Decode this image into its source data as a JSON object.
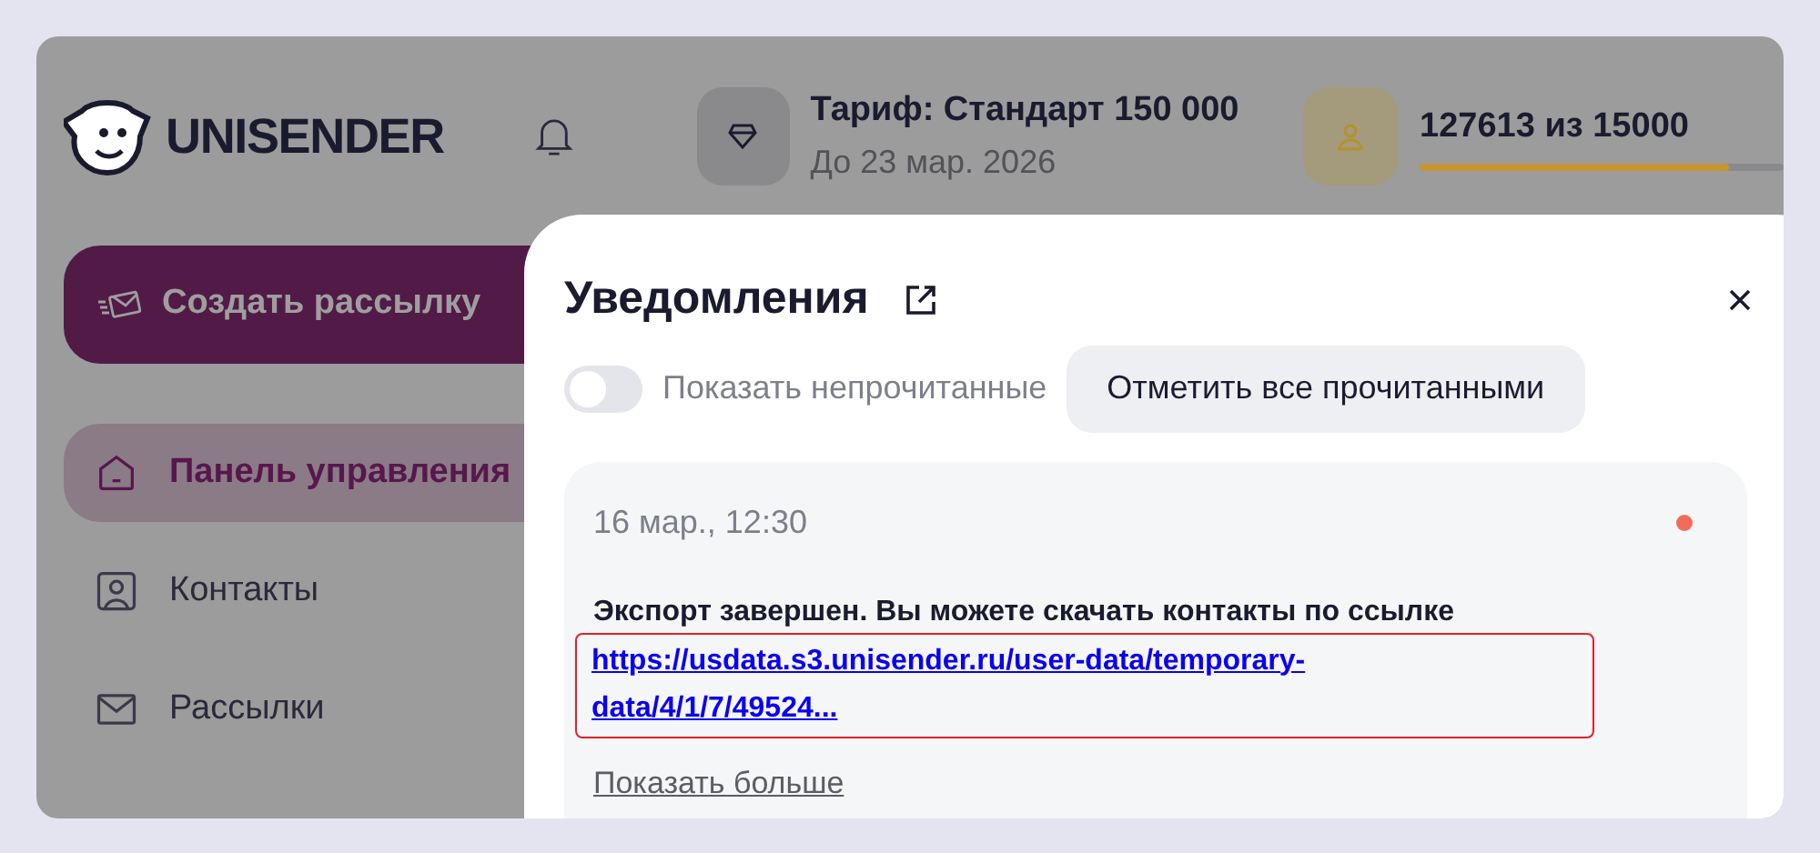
{
  "brand": {
    "name": "UNISENDER"
  },
  "header": {
    "tariff": "Тариф: Стандарт 150 000",
    "tariff_until": "До 23 мар. 2026",
    "contacts_usage": "127613 из 15000",
    "usage_meter": {
      "level": 0.85
    }
  },
  "sidebar": {
    "create_button": "Создать рассылку",
    "items": [
      {
        "label": "Панель управления",
        "kind": "home",
        "selected": true
      },
      {
        "label": "Контакты",
        "kind": "contact",
        "selected": false
      },
      {
        "label": "Рассылки",
        "kind": "mail",
        "selected": false
      }
    ]
  },
  "notifications": {
    "title": "Уведомления",
    "toggle": {
      "label": "Показать непрочитанные",
      "on": false
    },
    "mark_all_button": "Отметить все прочитанными",
    "items": [
      {
        "time": "16 мар., 12:30",
        "unread": true,
        "message": "Экспорт завершен. Вы можете скачать контакты по ссылке",
        "link": "https://usdata.s3.unisender.ru/user-data/temporary-data/4/1/7/49524...",
        "link_highlighted": true,
        "show_more": "Показать больше"
      }
    ]
  }
}
